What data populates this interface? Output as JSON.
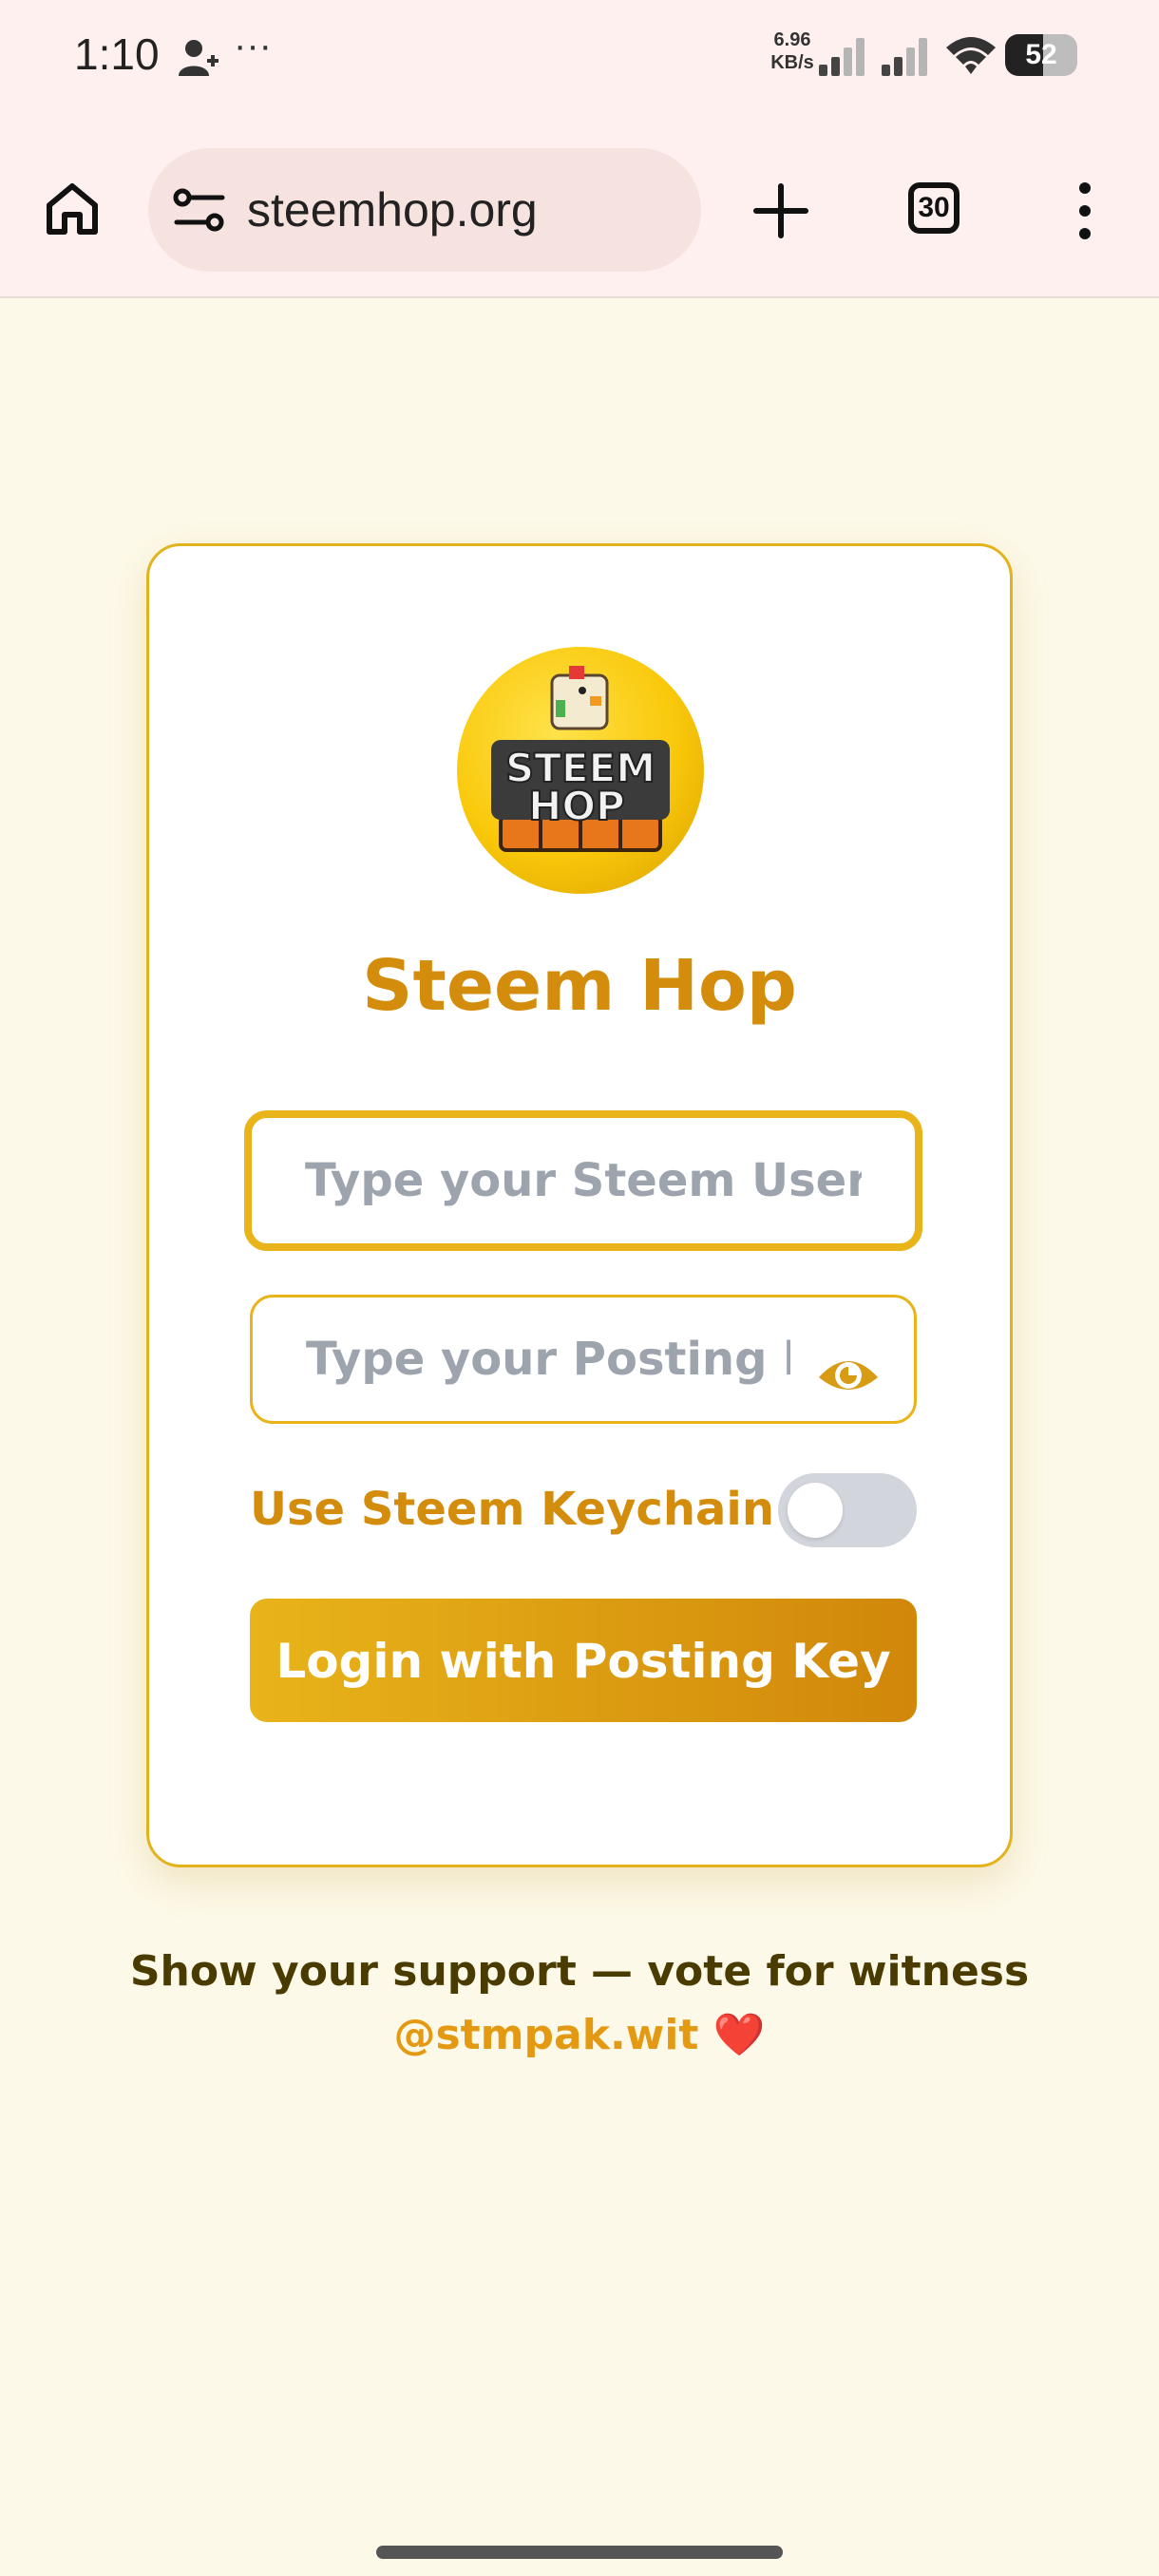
{
  "status_bar": {
    "time": "1:10",
    "dots": "···",
    "speed_value": "6.96",
    "speed_unit": "KB/s",
    "battery": "52",
    "battery_level": 0.52,
    "icons": [
      "person-icon",
      "signal-icon",
      "signal-icon",
      "wifi-icon",
      "battery-icon"
    ]
  },
  "browser": {
    "url": "steemhop.org",
    "tab_count": "30",
    "icons": [
      "home-icon",
      "tune-icon",
      "plus-icon",
      "tabs-icon",
      "more-vert-icon"
    ]
  },
  "app": {
    "logo_text": [
      "STEEM",
      "HOP"
    ],
    "title": "Steem Hop",
    "username_placeholder": "Type your Steem Username",
    "posting_key_placeholder": "Type your Posting key",
    "keychain_label": "Use Steem Keychain",
    "keychain_enabled": false,
    "login_button": "Login with Posting Key"
  },
  "footer": {
    "support_text": "Show your support — vote for witness",
    "witness": "@stmpak.wit",
    "heart": "❤️"
  },
  "colors": {
    "accent": "#e8b41a",
    "title": "#d48c0c",
    "page_background": "#fdf9e8",
    "browser_chrome": "#fdf0ee"
  }
}
